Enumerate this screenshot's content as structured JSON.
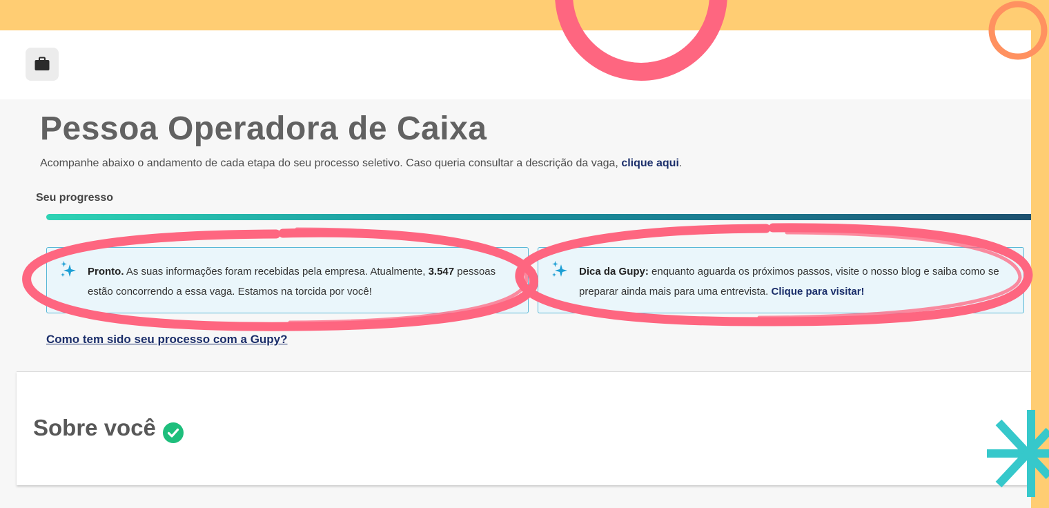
{
  "page": {
    "title": "Pessoa Operadora de Caixa",
    "subtitle": "Acompanhe abaixo o andamento de cada etapa do seu processo seletivo. Caso queria consultar a descrição da vaga,",
    "subtitle_link": "clique aqui",
    "subtitle_end": "."
  },
  "header": {
    "briefcase_icon": "briefcase-icon"
  },
  "progress": {
    "label": "Seu progresso",
    "value": 1.0
  },
  "status_card": {
    "lead": "Pronto.",
    "text1": " As suas informações foram recebidas pela empresa. Atualmente, ",
    "count": "3.547",
    "text2": " pessoas estão concorrendo a essa vaga. Estamos na torcida por você!"
  },
  "tip_card": {
    "lead": "Dica da Gupy:",
    "text": " enquanto aguarda os próximos passos, visite o nosso blog e saiba como se preparar ainda mais para uma entrevista. ",
    "link": "Clique para visitar!"
  },
  "feedback_link": "Como tem sido seu processo com a Gupy?",
  "about": {
    "title": "Sobre você",
    "status_icon": "check-circle-icon"
  },
  "colors": {
    "accent_dark": "#1b2e6a",
    "progress_start": "#2ed3b4",
    "progress_end": "#1d4f6e",
    "card_border": "#58b7d6",
    "card_bg": "#eaf6fb",
    "check_green": "#1ebe7c",
    "background_yellow": "#ffcd73",
    "circle_pink": "#fe6680",
    "circle_orange": "#ff9160",
    "star_teal": "#36c8cb"
  }
}
